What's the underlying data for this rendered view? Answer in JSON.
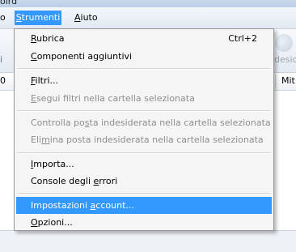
{
  "window": {
    "title_partial": "oird"
  },
  "menubar": {
    "partial_left": "o",
    "strumenti_label": "Strumenti",
    "strumenti_mnemonic": "S",
    "strumenti_rest": "trumenti",
    "aiuto_label": "Aiuto",
    "aiuto_mnemonic": "A",
    "aiuto_rest": "iuto"
  },
  "toolbar": {
    "partial_left": "i",
    "partial_right": "desic",
    "right_icon": "flame-icon"
  },
  "column_header": {
    "partial_left": "0",
    "partial_right": "Mit"
  },
  "menu": {
    "items": [
      {
        "pre": "",
        "key": "R",
        "post": "ubrica",
        "shortcut": "Ctrl+2",
        "disabled": false,
        "highlighted": false
      },
      {
        "pre": "",
        "key": "C",
        "post": "omponenti aggiuntivi",
        "shortcut": "",
        "disabled": false,
        "highlighted": false
      },
      {
        "pre": "",
        "key": "F",
        "post": "iltri...",
        "shortcut": "",
        "disabled": false,
        "highlighted": false
      },
      {
        "pre": "",
        "key": "E",
        "post": "segui filtri nella cartella selezionata",
        "shortcut": "",
        "disabled": true,
        "highlighted": false
      },
      {
        "pre": "Controlla po",
        "key": "s",
        "post": "ta indesiderata nella cartella selezionata",
        "shortcut": "",
        "disabled": true,
        "highlighted": false
      },
      {
        "pre": "Eli",
        "key": "m",
        "post": "ina posta indesiderata nella cartella selezionata",
        "shortcut": "",
        "disabled": true,
        "highlighted": false
      },
      {
        "pre": "",
        "key": "I",
        "post": "mporta...",
        "shortcut": "",
        "disabled": false,
        "highlighted": false
      },
      {
        "pre": "Console degli ",
        "key": "e",
        "post": "rrori",
        "shortcut": "",
        "disabled": false,
        "highlighted": false
      },
      {
        "pre": "Impostazioni ",
        "key": "a",
        "post": "ccount...",
        "shortcut": "",
        "disabled": false,
        "highlighted": true
      },
      {
        "pre": "",
        "key": "O",
        "post": "pzioni...",
        "shortcut": "",
        "disabled": false,
        "highlighted": false
      }
    ]
  },
  "colors": {
    "highlight": "#3399ff",
    "disabled_text": "#8d8d8d",
    "menu_background": "#f5f5f5"
  }
}
